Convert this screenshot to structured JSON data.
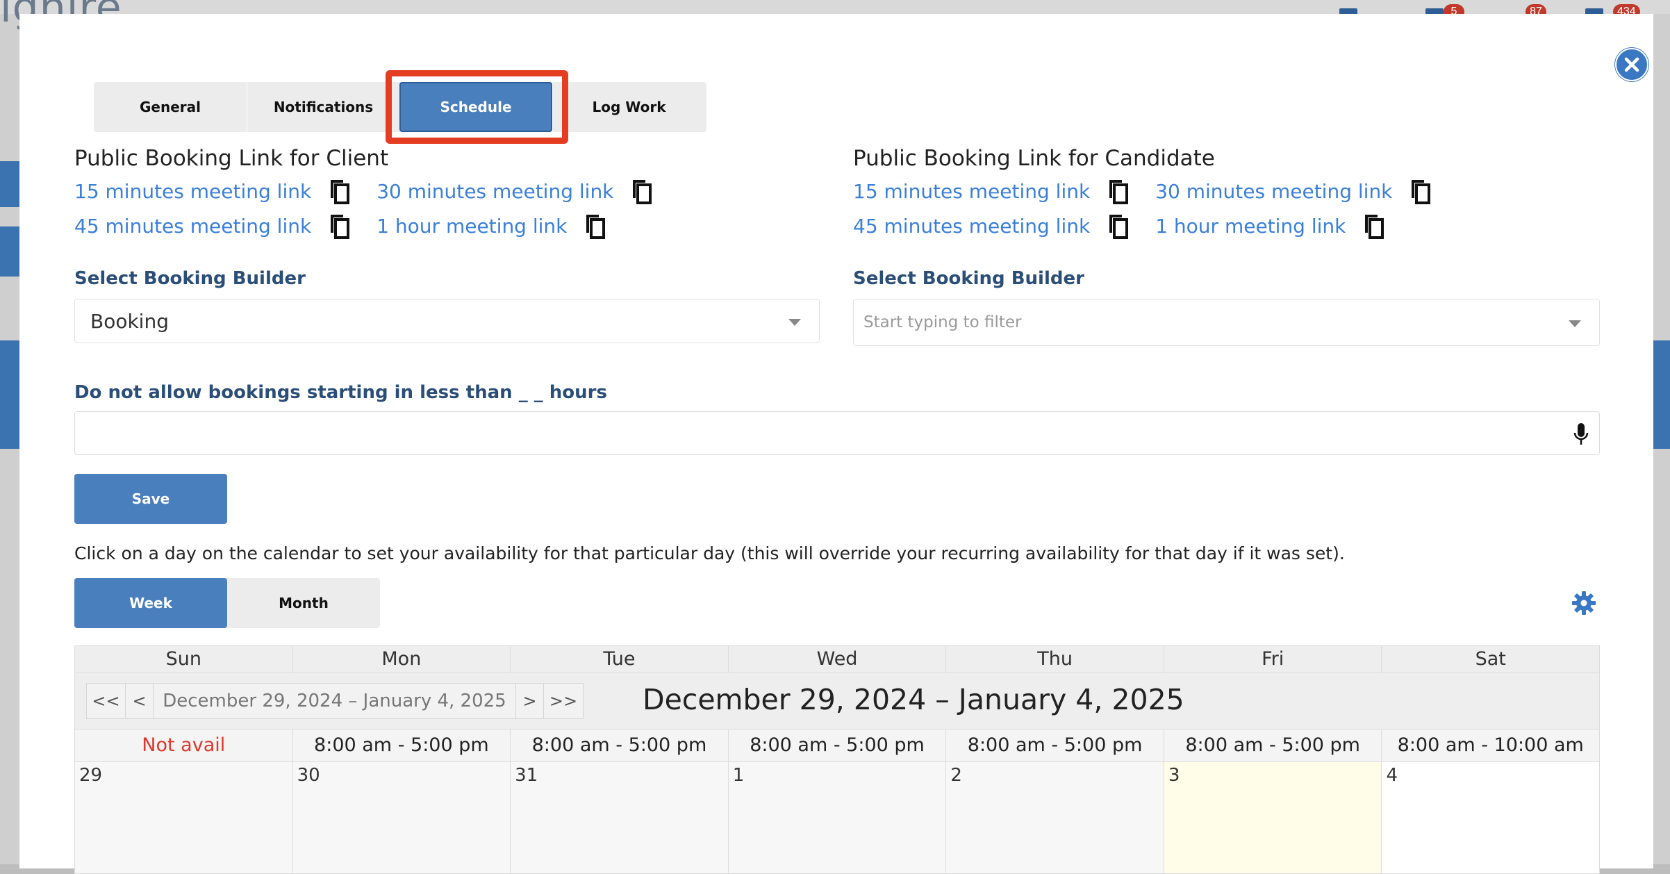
{
  "background": {
    "logo": "lghire",
    "badges": [
      "5",
      "87",
      "434"
    ]
  },
  "tabs": [
    {
      "label": "General"
    },
    {
      "label": "Notifications"
    },
    {
      "label": "Schedule"
    },
    {
      "label": "Log Work"
    }
  ],
  "active_tab": "Schedule",
  "client_links": {
    "title": "Public Booking Link for Client",
    "links": [
      "15 minutes meeting link",
      "30 minutes meeting link",
      "45 minutes meeting link",
      "1 hour meeting link"
    ]
  },
  "candidate_links": {
    "title": "Public Booking Link for Candidate",
    "links": [
      "15 minutes meeting link",
      "30 minutes meeting link",
      "45 minutes meeting link",
      "1 hour meeting link"
    ]
  },
  "client_builder": {
    "label": "Select Booking Builder",
    "value": "Booking"
  },
  "candidate_builder": {
    "label": "Select Booking Builder",
    "placeholder": "Start typing to filter"
  },
  "min_hours": {
    "label": "Do not allow bookings starting in less than _ _ hours",
    "value": ""
  },
  "save_label": "Save",
  "instruction": "Click on a day on the calendar to set your availability for that particular day (this will override your recurring availability for that day if it was set).",
  "view_toggle": {
    "week": "Week",
    "month": "Month",
    "active": "Week"
  },
  "calendar": {
    "weekdays": [
      "Sun",
      "Mon",
      "Tue",
      "Wed",
      "Thu",
      "Fri",
      "Sat"
    ],
    "nav": {
      "first": "<<",
      "prev": "<",
      "range": "December 29, 2024 – January 4, 2025",
      "next": ">",
      "last": ">>"
    },
    "title": "December 29, 2024 – January 4, 2025",
    "availability": [
      "Not avail",
      "8:00 am - 5:00 pm",
      "8:00 am - 5:00 pm",
      "8:00 am - 5:00 pm",
      "8:00 am - 5:00 pm",
      "8:00 am - 5:00 pm",
      "8:00 am - 10:00 am"
    ],
    "days": [
      "29",
      "30",
      "31",
      "1",
      "2",
      "3",
      "4"
    ],
    "today_index": 5
  },
  "colors": {
    "primary": "#4a7fbd",
    "link": "#3a7fd9",
    "highlight": "#e53d22",
    "not_available": "#e0372c",
    "today": "#fffde7"
  },
  "icons": [
    "close-icon",
    "copy-icon",
    "caret-down-icon",
    "microphone-icon",
    "gear-icon"
  ]
}
